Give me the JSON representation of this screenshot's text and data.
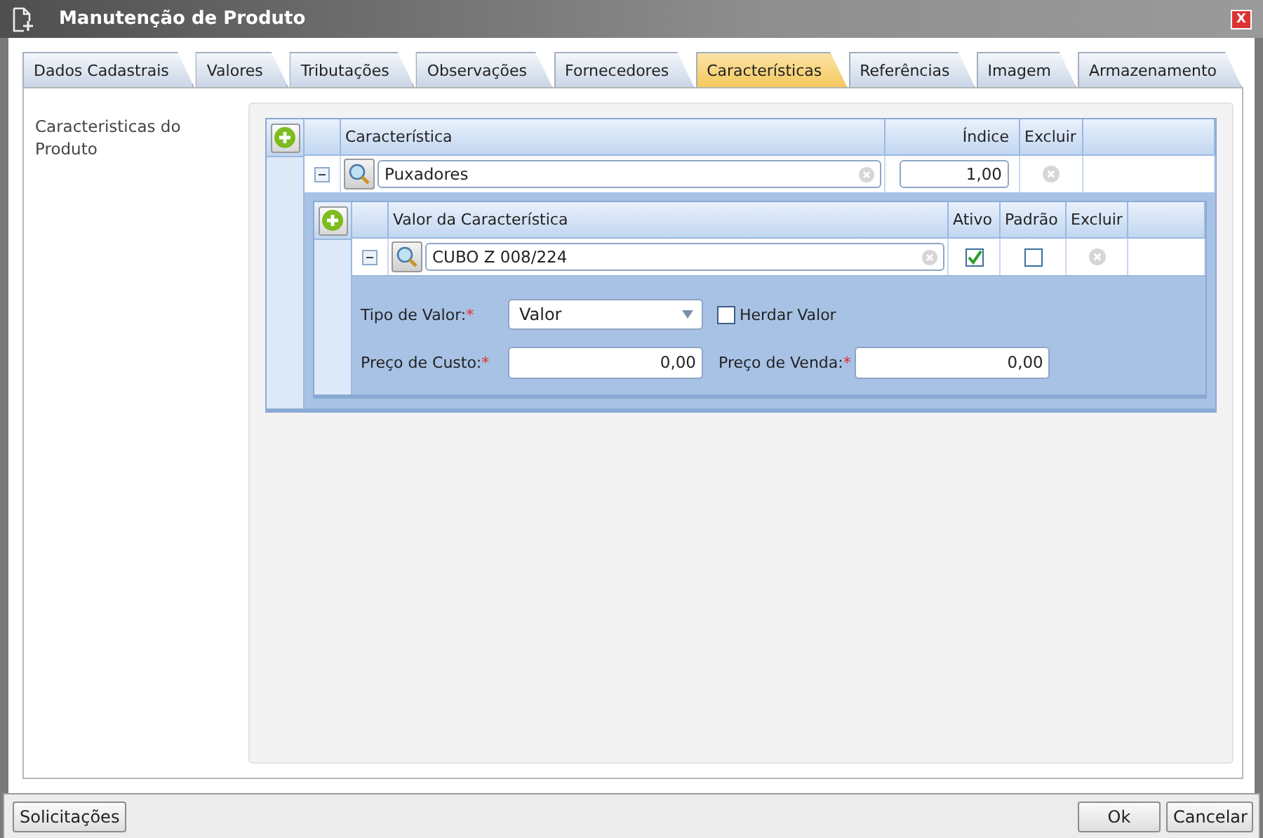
{
  "window": {
    "title": "Manutenção de Produto",
    "close_label": "X"
  },
  "tabs": [
    {
      "label": "Dados Cadastrais",
      "selected": false
    },
    {
      "label": "Valores",
      "selected": false
    },
    {
      "label": "Tributações",
      "selected": false
    },
    {
      "label": "Observações",
      "selected": false
    },
    {
      "label": "Fornecedores",
      "selected": false
    },
    {
      "label": "Características",
      "selected": true
    },
    {
      "label": "Referências",
      "selected": false
    },
    {
      "label": "Imagem",
      "selected": false
    },
    {
      "label": "Armazenamento",
      "selected": false
    }
  ],
  "section_label": "Caracteristicas do Produto",
  "grid": {
    "columns": [
      "Característica",
      "Índice",
      "Excluir"
    ],
    "rows": [
      {
        "expanded": true,
        "caracteristica": "Puxadores",
        "indice": "1,00",
        "values_grid": {
          "columns": [
            "Valor da Característica",
            "Ativo",
            "Padrão",
            "Excluir"
          ],
          "rows": [
            {
              "expanded": true,
              "value": "CUBO Z 008/224",
              "ativo": true,
              "padrao": false,
              "tipo_valor": {
                "label": "Tipo de Valor:",
                "required_mark": "*",
                "value": "Valor"
              },
              "herdar_valor": {
                "label": "Herdar Valor",
                "checked": false
              },
              "preco_custo": {
                "label": "Preço de Custo:",
                "required_mark": "*",
                "value": "0,00"
              },
              "preco_venda": {
                "label": "Preço de Venda:",
                "required_mark": "*",
                "value": "0,00"
              }
            }
          ]
        }
      }
    ]
  },
  "footer": {
    "left_button": "Solicitações",
    "right_buttons": [
      "Ok",
      "Cancelar"
    ]
  }
}
